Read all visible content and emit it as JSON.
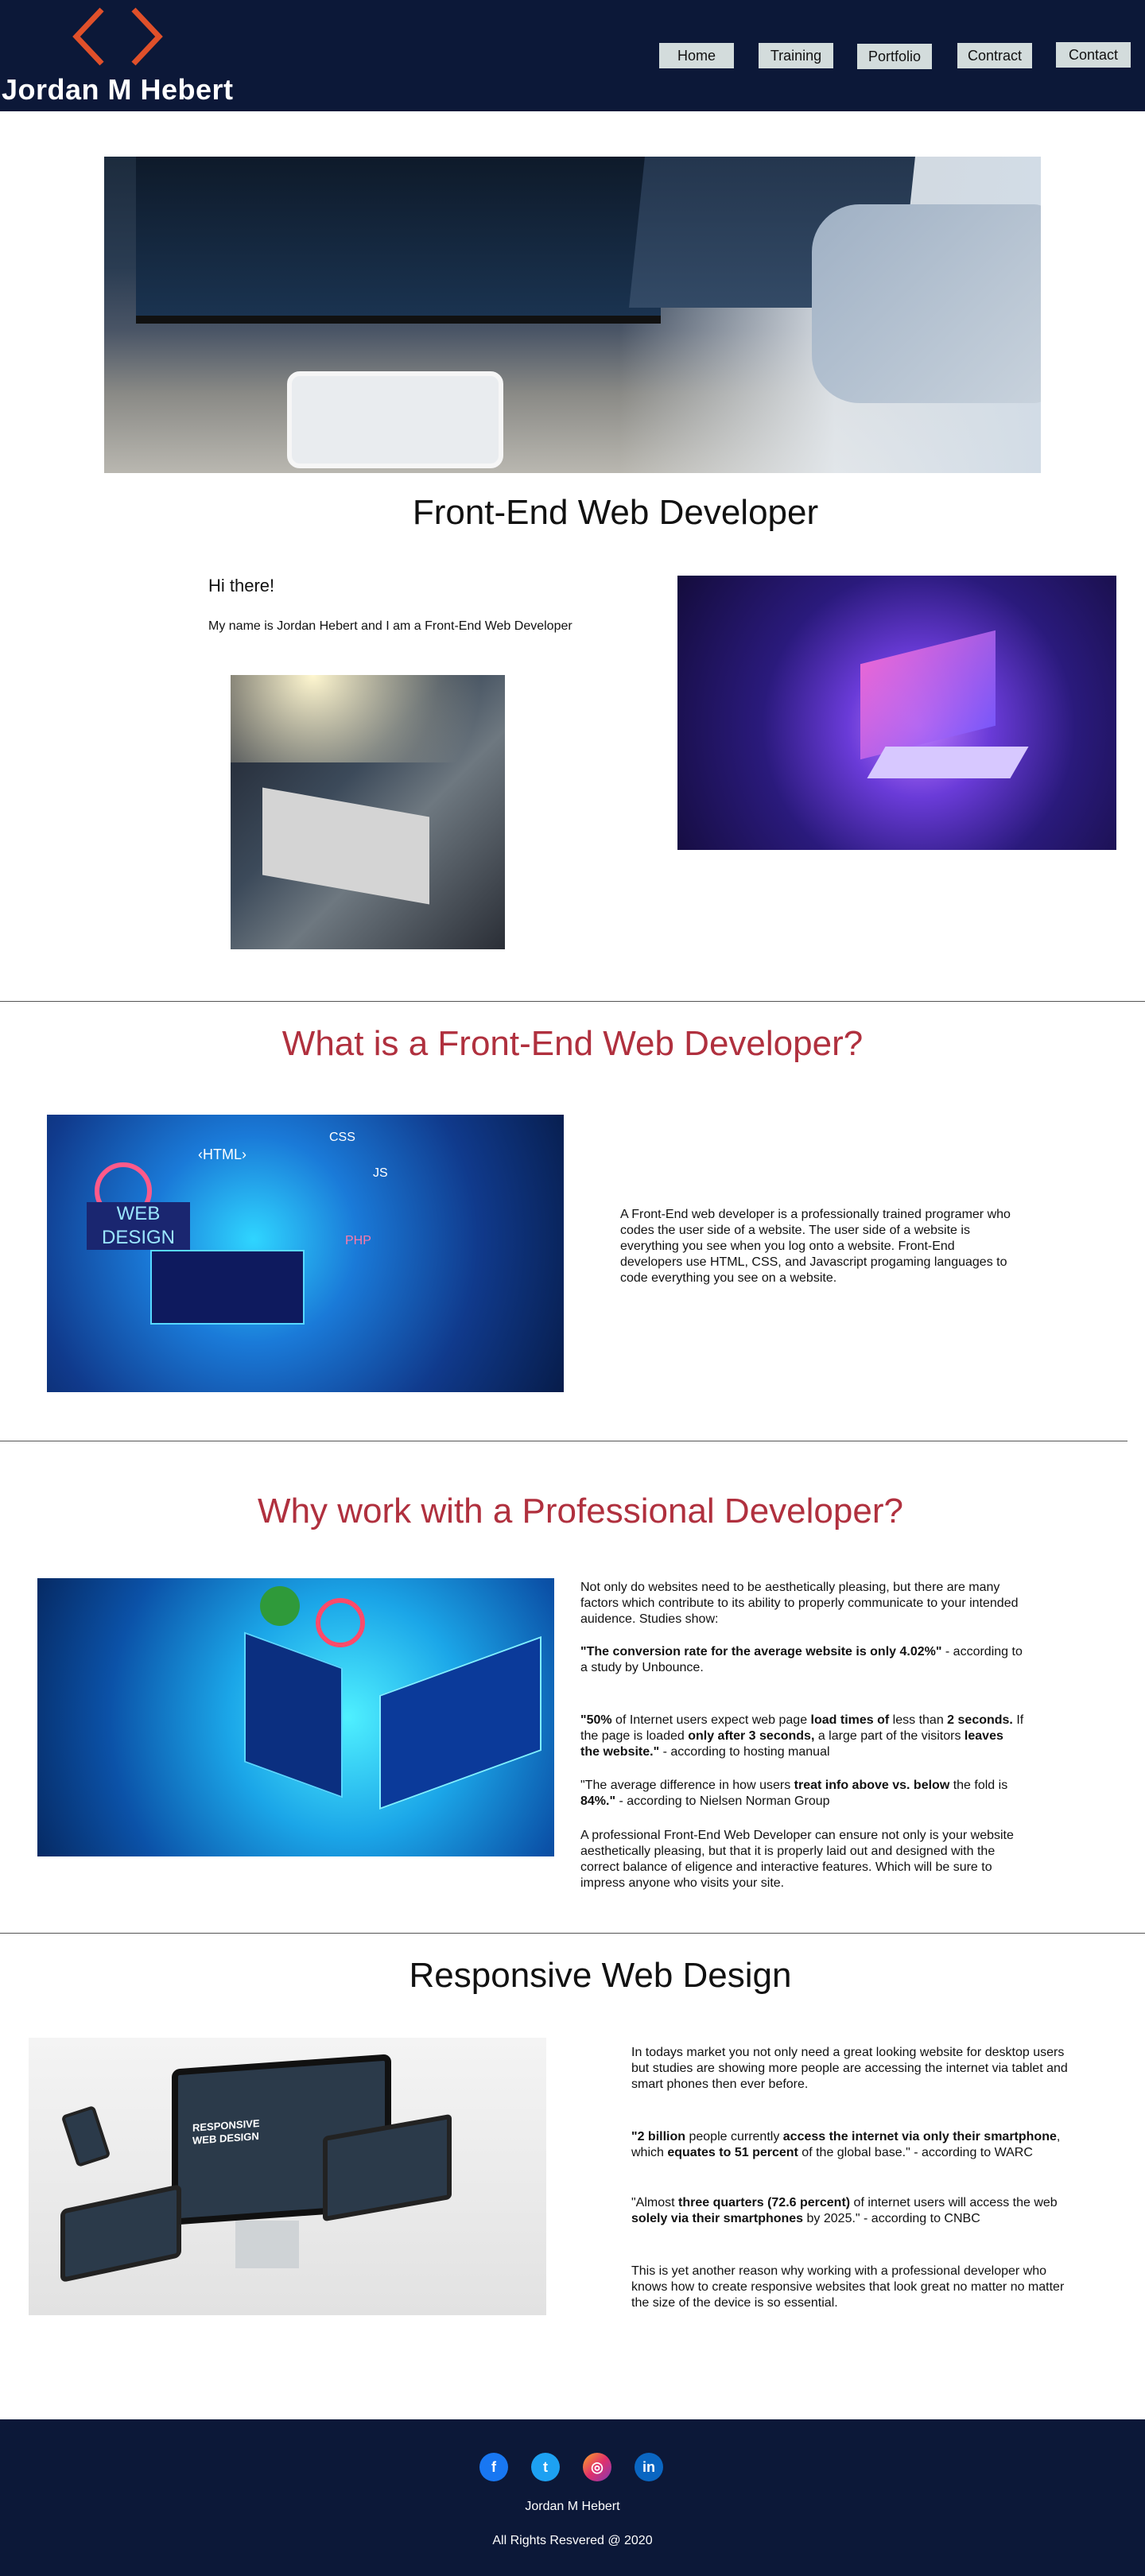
{
  "header": {
    "brand": "Jordan M Hebert",
    "nav": [
      "Home",
      "Training",
      "Portfolio",
      "Contract",
      "Contact"
    ]
  },
  "hero": {
    "title": "Front-End Web Developer"
  },
  "intro": {
    "greeting": "Hi there!",
    "text": "My name is Jordan Hebert and I am a Front-End Web Developer"
  },
  "what": {
    "title": "What is a Front-End Web Developer?",
    "text": "A Front-End web developer is a professionally trained programer who codes the user side of a website.  The user side of a website is everything you see when you log onto a website. Front-End developers use HTML, CSS, and Javascript progaming languages to code everything you see on a website."
  },
  "why": {
    "title": "Why work with a Professional Developer?",
    "p1": "Not only do websites need to be aesthetically pleasing, but there are many factors which contribute to its ability to properly communicate to your intended auidence.  Studies show:",
    "p2_bold": "\"The conversion rate for the average website is only 4.02%\"",
    "p2_rest": " - according to a study by Unbounce.",
    "p3_a": "\"50%",
    "p3_b": " of Internet users expect web page ",
    "p3_c": "load times of",
    "p3_d": " less than ",
    "p3_e": "2 seconds.",
    "p3_f": " If the page is loaded ",
    "p3_g": "only after 3 seconds,",
    "p3_h": " a large part of the visitors ",
    "p3_i": "leaves the website.\"",
    "p3_j": " - according to hosting manual",
    "p4_a": "\"The average difference in how users ",
    "p4_b": "treat info above vs. below",
    "p4_c": " the fold is ",
    "p4_d": "84%.\"",
    "p4_e": " - according to Nielsen Norman Group",
    "p5": "A professional Front-End Web Developer can ensure not only is your website aesthetically pleasing, but that it is properly laid out and designed with the correct balance of eligence and interactive features. Which will be sure to impress anyone who visits your site."
  },
  "responsive": {
    "title": "Responsive Web Design",
    "p1": "In todays market you not only need a great looking website for desktop users but studies are showing more people are accessing the internet via tablet and smart phones then ever before.",
    "p2_a": "\"2 billion",
    "p2_b": " people currently ",
    "p2_c": "access the internet via only their smartphone",
    "p2_d": ", which ",
    "p2_e": "equates to 51 percent",
    "p2_f": " of the global base.\" - according to WARC",
    "p3_a": "\"Almost ",
    "p3_b": "three quarters (72.6 percent)",
    "p3_c": " of internet users will access the web ",
    "p3_d": "solely via their smartphones",
    "p3_e": " by 2025.\" - according to CNBC",
    "p4": "This is yet another reason why working with a professional developer who knows how to create responsive websites that look great no matter no matter the size of the device is so essential.",
    "img_caption": "RESPONSIVE WEB DESIGN"
  },
  "footer": {
    "social": [
      "f",
      "t",
      "◎",
      "in"
    ],
    "name": "Jordan M Hebert",
    "copyright": "All Rights Resvered @ 2020"
  },
  "colors": {
    "header_bg": "#0c1838",
    "nav_bg": "#d3dcdc",
    "accent_red": "#b0303e",
    "logo_orange": "#e0502a",
    "facebook": "#1877f2",
    "twitter": "#1da1f2",
    "instagram": "#c13584",
    "linkedin": "#0a66c2"
  }
}
